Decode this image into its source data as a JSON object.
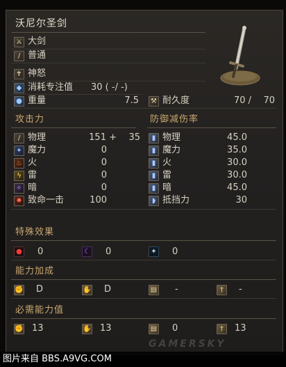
{
  "weapon": {
    "name": "沃尼尔圣剑",
    "category": "大剑",
    "attack_type": "普通",
    "skill": "神怒",
    "fp_cost_label": "消耗专注值",
    "fp_cost_value": "30 (   -/   -)",
    "weight_label": "重量",
    "weight_value": "7.5",
    "durability_label": "耐久度",
    "durability_value": "70 /",
    "durability_max": "70"
  },
  "attack": {
    "header": "攻击力",
    "rows": [
      {
        "label": "物理",
        "value": "151 +",
        "bonus": "35",
        "icon": "sword-icon"
      },
      {
        "label": "魔力",
        "value": "0",
        "icon": "magic-icon"
      },
      {
        "label": "火",
        "value": "0",
        "icon": "fire-icon"
      },
      {
        "label": "雷",
        "value": "0",
        "icon": "lightning-icon"
      },
      {
        "label": "暗",
        "value": "0",
        "icon": "dark-icon"
      },
      {
        "label": "致命一击",
        "value": "100",
        "icon": "critical-icon"
      }
    ]
  },
  "defense": {
    "header": "防御减伤率",
    "rows": [
      {
        "label": "物理",
        "value": "45.0",
        "icon": "physical-guard-icon"
      },
      {
        "label": "魔力",
        "value": "35.0",
        "icon": "magic-guard-icon"
      },
      {
        "label": "火",
        "value": "30.0",
        "icon": "fire-guard-icon"
      },
      {
        "label": "雷",
        "value": "30.0",
        "icon": "lightning-guard-icon"
      },
      {
        "label": "暗",
        "value": "45.0",
        "icon": "dark-guard-icon"
      },
      {
        "label": "抵挡力",
        "value": "30",
        "icon": "stability-icon"
      }
    ]
  },
  "effects": {
    "header": "特殊效果",
    "items": [
      {
        "value": "0",
        "icon": "bleed-icon"
      },
      {
        "value": "0",
        "icon": "poison-icon"
      },
      {
        "value": "0",
        "icon": "frost-icon"
      }
    ]
  },
  "scaling": {
    "header": "能力加成",
    "items": [
      {
        "value": "D",
        "icon": "strength-icon"
      },
      {
        "value": "D",
        "icon": "dexterity-icon"
      },
      {
        "value": "-",
        "icon": "intelligence-icon"
      },
      {
        "value": "-",
        "icon": "faith-icon"
      }
    ]
  },
  "requirements": {
    "header": "必需能力值",
    "items": [
      {
        "value": "13",
        "icon": "strength-icon"
      },
      {
        "value": "13",
        "icon": "dexterity-icon"
      },
      {
        "value": "0",
        "icon": "intelligence-icon"
      },
      {
        "value": "13",
        "icon": "faith-icon"
      }
    ]
  },
  "watermark": {
    "source": "图片来自 BBS.A9VG.COM",
    "brand": "GAMERSKY"
  }
}
